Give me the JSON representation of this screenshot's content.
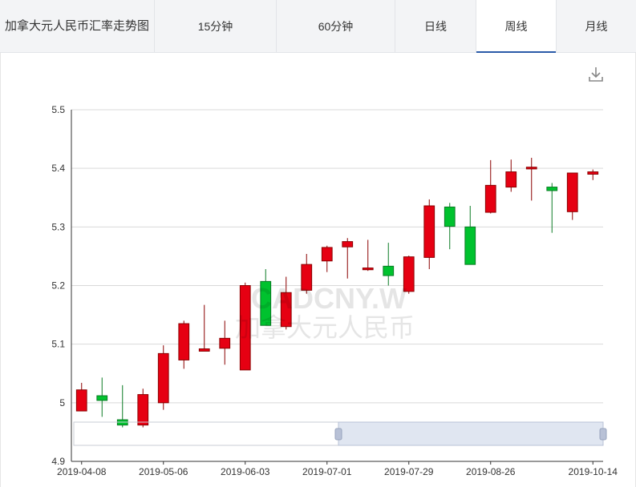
{
  "header": {
    "title": "加拿大元人民币汇率走势图",
    "tabs": [
      {
        "label": "15分钟",
        "active": false
      },
      {
        "label": "60分钟",
        "active": false
      },
      {
        "label": "日线",
        "active": false
      },
      {
        "label": "周线",
        "active": true
      },
      {
        "label": "月线",
        "active": false
      }
    ],
    "active_tab_color": "#2b5ba8"
  },
  "toolbar": {
    "download_icon": "download-icon"
  },
  "watermark": {
    "code": "CADCNY.W",
    "name": "加拿大元人民币"
  },
  "chart_data": {
    "type": "candlestick",
    "ylim": [
      4.9,
      5.5
    ],
    "yticks": [
      "4.9",
      "5",
      "5.1",
      "5.2",
      "5.3",
      "5.4",
      "5.5"
    ],
    "xtick_labels": [
      "2019-04-08",
      "2019-05-06",
      "2019-06-03",
      "2019-07-01",
      "2019-07-29",
      "2019-08-26",
      "2019-10-14"
    ],
    "up_color": "#e60012",
    "down_color": "#00c22e",
    "grid": true,
    "candles": [
      {
        "open": 4.986,
        "close": 5.022,
        "high": 5.034,
        "low": 4.986
      },
      {
        "open": 5.012,
        "close": 5.004,
        "high": 5.043,
        "low": 4.976
      },
      {
        "open": 4.971,
        "close": 4.962,
        "high": 5.03,
        "low": 4.958
      },
      {
        "open": 4.962,
        "close": 5.014,
        "high": 5.024,
        "low": 4.958
      },
      {
        "open": 5.0,
        "close": 5.084,
        "high": 5.098,
        "low": 4.988
      },
      {
        "open": 5.073,
        "close": 5.135,
        "high": 5.14,
        "low": 5.058
      },
      {
        "open": 5.088,
        "close": 5.092,
        "high": 5.167,
        "low": 5.088
      },
      {
        "open": 5.093,
        "close": 5.11,
        "high": 5.14,
        "low": 5.065
      },
      {
        "open": 5.056,
        "close": 5.2,
        "high": 5.205,
        "low": 5.056
      },
      {
        "open": 5.207,
        "close": 5.132,
        "high": 5.228,
        "low": 5.132
      },
      {
        "open": 5.13,
        "close": 5.188,
        "high": 5.215,
        "low": 5.125
      },
      {
        "open": 5.192,
        "close": 5.236,
        "high": 5.254,
        "low": 5.186
      },
      {
        "open": 5.242,
        "close": 5.265,
        "high": 5.268,
        "low": 5.223
      },
      {
        "open": 5.266,
        "close": 5.275,
        "high": 5.281,
        "low": 5.212
      },
      {
        "open": 5.227,
        "close": 5.23,
        "high": 5.278,
        "low": 5.225
      },
      {
        "open": 5.233,
        "close": 5.217,
        "high": 5.273,
        "low": 5.2
      },
      {
        "open": 5.19,
        "close": 5.249,
        "high": 5.251,
        "low": 5.186
      },
      {
        "open": 5.248,
        "close": 5.336,
        "high": 5.347,
        "low": 5.228
      },
      {
        "open": 5.334,
        "close": 5.301,
        "high": 5.341,
        "low": 5.262
      },
      {
        "open": 5.3,
        "close": 5.236,
        "high": 5.336,
        "low": 5.236
      },
      {
        "open": 5.325,
        "close": 5.371,
        "high": 5.414,
        "low": 5.323
      },
      {
        "open": 5.368,
        "close": 5.394,
        "high": 5.415,
        "low": 5.36
      },
      {
        "open": 5.399,
        "close": 5.402,
        "high": 5.418,
        "low": 5.345
      },
      {
        "open": 5.368,
        "close": 5.362,
        "high": 5.375,
        "low": 5.29
      },
      {
        "open": 5.326,
        "close": 5.392,
        "high": 5.392,
        "low": 5.312
      },
      {
        "open": 5.39,
        "close": 5.394,
        "high": 5.398,
        "low": 5.38
      }
    ],
    "zoom_range": [
      0.5,
      1.0
    ]
  }
}
